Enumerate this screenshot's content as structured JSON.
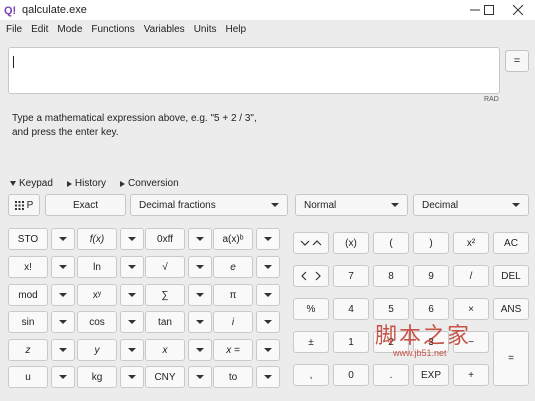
{
  "window": {
    "title": "qalculate.exe"
  },
  "menu": [
    "File",
    "Edit",
    "Mode",
    "Functions",
    "Variables",
    "Units",
    "Help"
  ],
  "expression": {
    "value": ""
  },
  "equals_label": "=",
  "angle_unit": "RAD",
  "hint": {
    "line1": "Type a mathematical expression above, e.g. \"5 + 2 / 3\",",
    "line2": "and press the enter key."
  },
  "tabs": [
    "Keypad",
    "History",
    "Conversion"
  ],
  "options": {
    "keypad_switch": "P",
    "exact": "Exact",
    "fractions": "Decimal fractions",
    "display": "Normal",
    "base": "Decimal"
  },
  "keypad_left": [
    [
      "STO",
      "f(x)",
      "0xff",
      "a(x)ᵇ"
    ],
    [
      "x!",
      "ln",
      "√",
      "e"
    ],
    [
      "mod",
      "xʸ",
      "∑",
      "π"
    ],
    [
      "sin",
      "cos",
      "tan",
      "i"
    ],
    [
      "z",
      "y",
      "x",
      "x ="
    ],
    [
      "u",
      "kg",
      "CNY",
      "to"
    ]
  ],
  "keypad_right": [
    [
      "(x)",
      "(",
      ")",
      "x²",
      "AC"
    ],
    [
      "7",
      "8",
      "9",
      "/",
      "DEL"
    ],
    [
      "4",
      "5",
      "6",
      "×",
      "ANS"
    ],
    [
      "1",
      "2",
      "3",
      "−",
      "="
    ],
    [
      "0",
      ".",
      "EXP",
      "+"
    ]
  ],
  "nav_labels": {
    "percent": "%",
    "plusminus": "±",
    "comma": ","
  },
  "watermark": {
    "text": "脚本之家",
    "url": "www.jb51.net",
    "color": "#c0392b"
  }
}
